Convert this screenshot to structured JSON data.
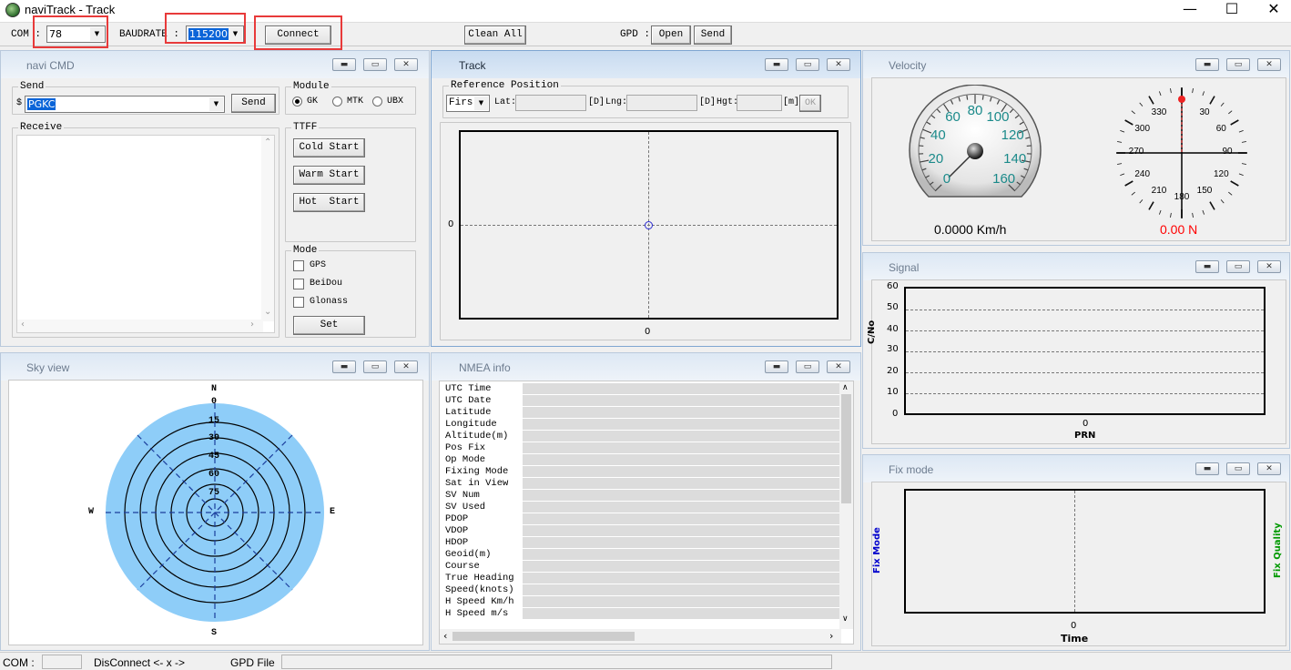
{
  "window": {
    "title": "naviTrack - Track",
    "minimize": "—",
    "maximize": "☐",
    "close": "✕"
  },
  "toolbar": {
    "com_label": "COM :",
    "com_value": "78",
    "baud_label": "BAUDRATE :",
    "baud_value": "115200",
    "connect": "Connect",
    "clean_all": "Clean All",
    "gpd_label": "GPD :",
    "open": "Open",
    "send": "Send"
  },
  "navi_cmd": {
    "title": "navi CMD",
    "send_group": "Send",
    "send_prefix": "$",
    "send_value": "PGKC",
    "send_button": "Send",
    "receive_group": "Receive",
    "module_group": "Module",
    "modules": [
      "GK",
      "MTK",
      "UBX"
    ],
    "module_selected": "GK",
    "ttff_group": "TTFF",
    "cold_start": "Cold Start",
    "warm_start": "Warm Start",
    "hot_start": "Hot  Start",
    "mode_group": "Mode",
    "modes": [
      "GPS",
      "BeiDou",
      "Glonass"
    ],
    "set": "Set"
  },
  "track": {
    "title": "Track",
    "ref_group": "Reference Position",
    "ref_select": "Firs",
    "lat_label": "Lat:",
    "deg1": "[D]",
    "lng_label": "Lng:",
    "deg2": "[D]",
    "hgt_label": "Hgt:",
    "m_label": "[m]",
    "ok": "OK",
    "y_tick": "0",
    "x_tick": "0"
  },
  "velocity": {
    "title": "Velocity",
    "speed_ticks": [
      "0",
      "20",
      "40",
      "60",
      "80",
      "100",
      "120",
      "140",
      "160"
    ],
    "speed_text": "0.0000 Km/h",
    "compass_ticks": [
      "330",
      "30",
      "300",
      "60",
      "270",
      "90",
      "240",
      "120",
      "210",
      "180",
      "150"
    ],
    "heading_text": "0.00 N",
    "heading_color": "#ff0000"
  },
  "signal": {
    "title": "Signal",
    "ylabel": "C/No",
    "xlabel": "PRN",
    "y_ticks": [
      "60",
      "50",
      "40",
      "30",
      "20",
      "10",
      "0"
    ],
    "x_tick": "0"
  },
  "fix_mode": {
    "title": "Fix mode",
    "left_label": "Fix Mode",
    "right_label": "Fix Quality",
    "x_tick": "0",
    "xlabel": "Time",
    "left_color": "#0000cc",
    "right_color": "#009900"
  },
  "sky_view": {
    "title": "Sky view",
    "north": "N",
    "south": "S",
    "east": "E",
    "west": "W",
    "elevations": [
      "0",
      "15",
      "30",
      "45",
      "60",
      "75"
    ],
    "fill_color": "#8ecdf8"
  },
  "nmea": {
    "title": "NMEA info",
    "rows": [
      "UTC Time",
      "UTC Date",
      "Latitude",
      "Longitude",
      "Altitude(m)",
      "Pos Fix",
      "Op Mode",
      "Fixing Mode",
      "Sat in View",
      "SV Num",
      "SV Used",
      "PDOP",
      "VDOP",
      "HDOP",
      "Geoid(m)",
      "Course",
      "True Heading",
      "Speed(knots)",
      "H Speed Km/h",
      "H Speed m/s"
    ]
  },
  "status": {
    "com_label": "COM :",
    "disconnect": "DisConnect <- x ->",
    "gpd_file": "GPD File"
  }
}
